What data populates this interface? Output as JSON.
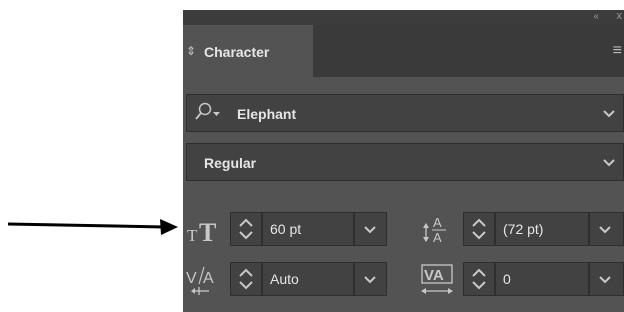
{
  "panel": {
    "tab_label": "Character",
    "tab_icon": "collapse-arrows-icon",
    "menu_icon": "panel-menu-icon",
    "collapse_glyph": "‹‹",
    "close_glyph": "x"
  },
  "font": {
    "family": "Elephant",
    "style": "Regular"
  },
  "metrics": {
    "font_size": "60 pt",
    "leading": "(72 pt)",
    "kerning": "Auto",
    "tracking": "0"
  },
  "colors": {
    "panel_bg": "#535353",
    "field_bg": "#424242",
    "text": "#e6e6e6",
    "icon": "#c8c8c8",
    "annotation_arrow": "#000000"
  }
}
